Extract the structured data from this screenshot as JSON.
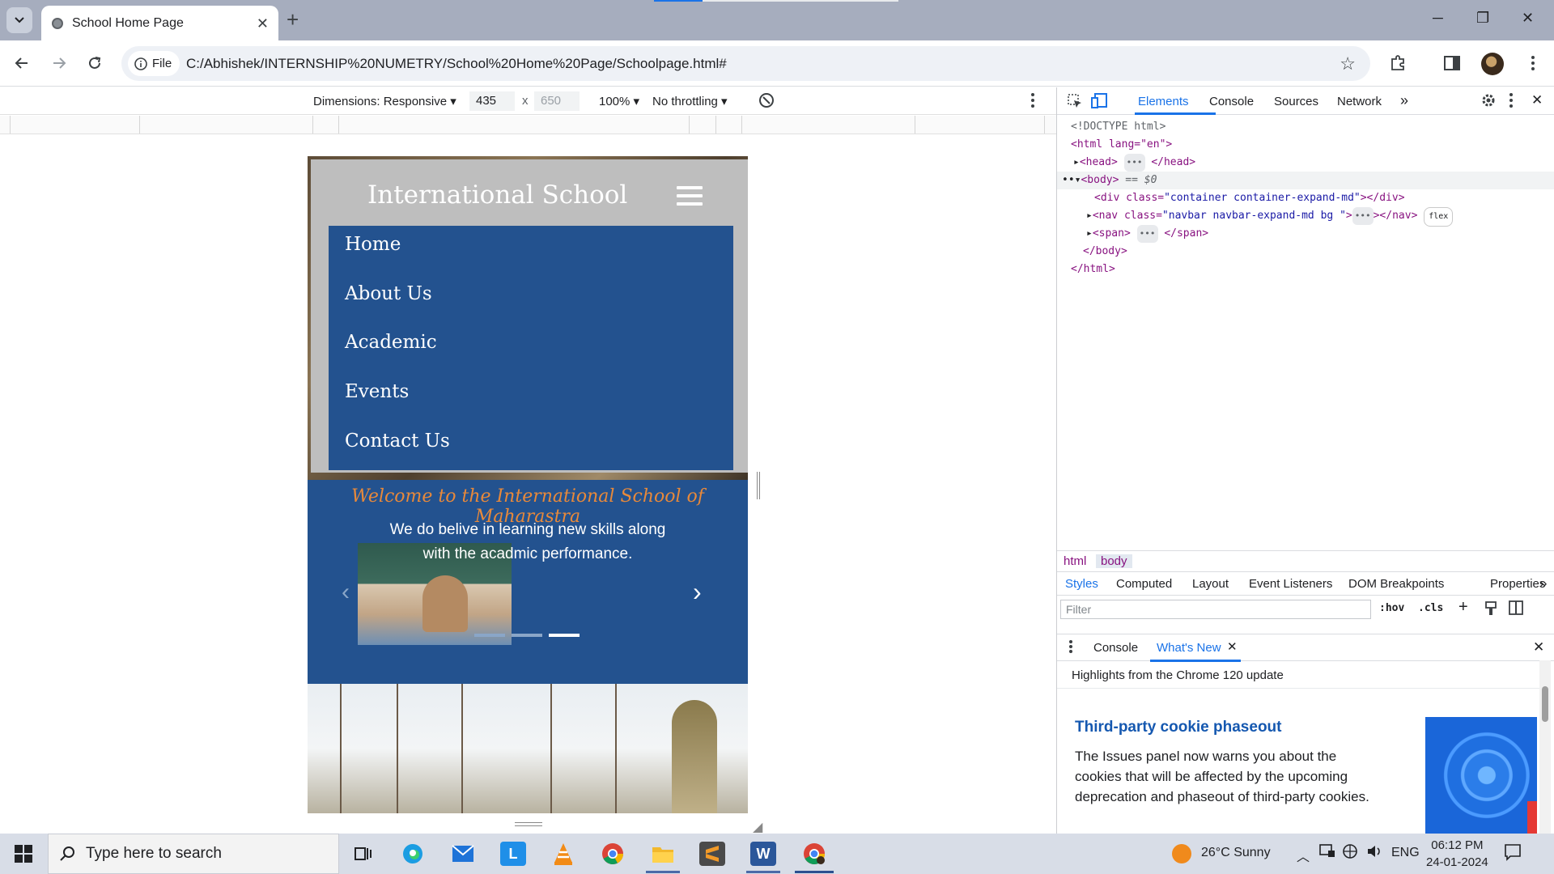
{
  "browser": {
    "tab_title": "School Home Page",
    "new_tab": "+",
    "close_tab": "✕",
    "chip_label": "File",
    "url": "C:/Abhishek/INTERNSHIP%20NUMETRY/School%20Home%20Page/Schoolpage.html#",
    "window_controls": {
      "minimize": "─",
      "maximize": "❐",
      "close": "✕"
    }
  },
  "device_toolbar": {
    "dimensions": "Dimensions: Responsive ▾",
    "width": "435",
    "times": "x",
    "height": "650",
    "zoom": "100% ▾",
    "throttling": "No throttling ▾"
  },
  "site": {
    "brand": "International School",
    "menu": [
      "Home",
      "About Us",
      "Academic",
      "Events",
      "Contact Us"
    ],
    "welcome": "Welcome to the International School of Maharastra",
    "carousel_text": "We do belive in learning new skills along with the acadmic performance.",
    "prev": "‹",
    "next": "›"
  },
  "devtools": {
    "tabs": [
      "Elements",
      "Console",
      "Sources",
      "Network",
      "»"
    ],
    "active_tab": "Elements",
    "dom": {
      "doctype": "<!DOCTYPE html>",
      "html_open": "<html lang=\"en\">",
      "head": "<head>",
      "head_close": "</head>",
      "body_open": "<body>",
      "body_suffix": "== $0",
      "div_tag": "<div class=",
      "div_class": "\"container container-expand-md\"",
      "div_close": "></div>",
      "nav_tag": "<nav class=",
      "nav_class": "\"navbar navbar-expand-md bg  \"",
      "nav_close": "></nav>",
      "flex_badge": "flex",
      "span_open": "<span>",
      "span_close": "</span>",
      "body_close": "</body>",
      "html_close": "</html>"
    },
    "breadcrumbs": [
      "html",
      "body"
    ],
    "styles_tabs": [
      "Styles",
      "Computed",
      "Layout",
      "Event Listeners",
      "DOM Breakpoints",
      "Properties",
      "»"
    ],
    "filter_placeholder": "Filter",
    "hov": ":hov",
    "cls": ".cls",
    "drawer_tabs": [
      "Console",
      "What's New"
    ],
    "highlights": "Highlights from the Chrome 120 update",
    "whats_new_title": "Third-party cookie phaseout",
    "whats_new_body": "The Issues panel now warns you about the cookies that will be affected by the upcoming deprecation and phaseout of third-party cookies."
  },
  "taskbar": {
    "search_placeholder": "Type here to search",
    "weather": "26°C  Sunny",
    "lang": "ENG",
    "time": "06:12 PM",
    "date": "24-01-2024",
    "app_l_letter": "L"
  },
  "colors": {
    "navbar_bg": "#bebebe",
    "menu_bg": "#23528f",
    "welcome_text": "#e8893a",
    "devtools_accent": "#1a73e8"
  }
}
